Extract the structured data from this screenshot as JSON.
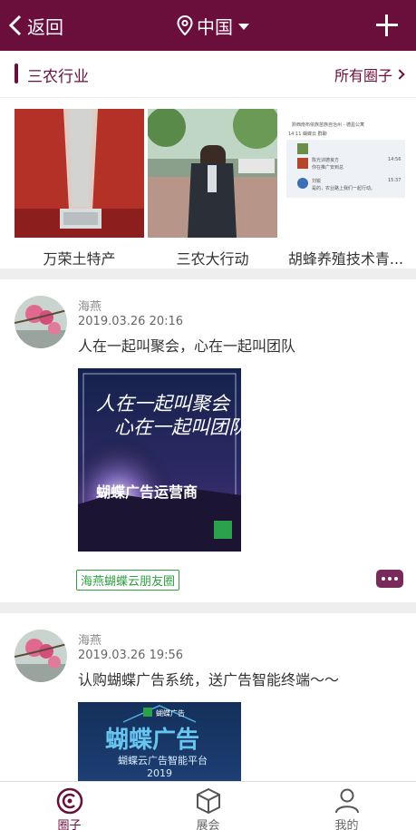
{
  "header": {
    "back_label": "返回",
    "location": "中国",
    "accent": "#6a0f3c"
  },
  "section": {
    "title": "三农行业",
    "all_link": "所有圈子"
  },
  "circles": [
    {
      "name": "万荣土特产"
    },
    {
      "name": "三农大行动"
    },
    {
      "name": "胡蜂养殖技术青..."
    }
  ],
  "thumb3": {
    "header": "黔西南布依族苗族自治州 - 德盈公寓",
    "sub": "14:11  蝴蝶云  群聊",
    "row1_name": "陈光训德良方",
    "row1_msg": "你在推广安到总",
    "row1_time": "14:56",
    "row2_name": "刘锐",
    "row2_msg": "是的，农业路上我们一起行动。",
    "row2_time": "15:37"
  },
  "posts": [
    {
      "author": "海燕",
      "time": "2019.03.26  20:16",
      "text": "人在一起叫聚会，心在一起叫团队",
      "image_line1": "人在一起叫聚会",
      "image_line2": "心在一起叫团队",
      "image_caption": "蝴蝶广告运营商",
      "tag": "海燕蝴蝶云朋友圈"
    },
    {
      "author": "海燕",
      "time": "2019.03.26  19:56",
      "text": "认购蝴蝶广告系统，送广告智能终端～～",
      "image_brand": "蝴蝶广告",
      "image_title": "蝴蝶广告",
      "image_sub": "蝴蝶云广告智能平台",
      "image_year": "2019"
    }
  ],
  "nav": [
    {
      "label": "圈子"
    },
    {
      "label": "展会"
    },
    {
      "label": "我的"
    }
  ]
}
